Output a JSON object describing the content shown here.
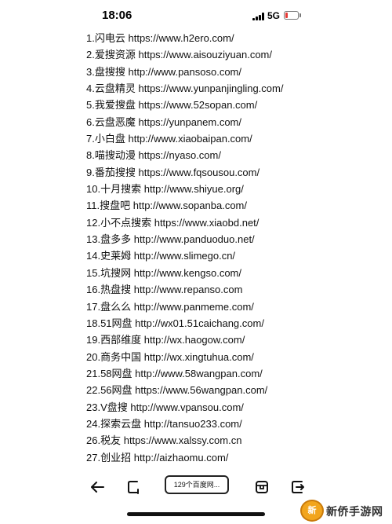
{
  "status_bar": {
    "time": "18:06",
    "network": "5G",
    "battery_level": 0.2
  },
  "sites": [
    {
      "num": "1.",
      "name": "闪电云",
      "url": "https://www.h2ero.com/"
    },
    {
      "num": "2.",
      "name": "爱搜资源",
      "url": "https://www.aisouziyuan.com/"
    },
    {
      "num": "3.",
      "name": "盘搜搜",
      "url": "http://www.pansoso.com/"
    },
    {
      "num": "4.",
      "name": "云盘精灵",
      "url": "https://www.yunpanjingling.com/"
    },
    {
      "num": "5.",
      "name": "我爱搜盘",
      "url": "https://www.52sopan.com/"
    },
    {
      "num": "6.",
      "name": "云盘恶魔",
      "url": "https://yunpanem.com/"
    },
    {
      "num": "7.",
      "name": "小白盘",
      "url": "http://www.xiaobaipan.com/"
    },
    {
      "num": "8.",
      "name": "喵搜动漫",
      "url": "https://nyaso.com/"
    },
    {
      "num": "9.",
      "name": "番茄搜搜",
      "url": "https://www.fqsousou.com/"
    },
    {
      "num": "10.",
      "name": "十月搜索",
      "url": "http://www.shiyue.org/"
    },
    {
      "num": "11.",
      "name": "搜盘吧",
      "url": "http://www.sopanba.com/"
    },
    {
      "num": "12.",
      "name": "小不点搜索",
      "url": "https://www.xiaobd.net/"
    },
    {
      "num": "13.",
      "name": "盘多多",
      "url": "http://www.panduoduo.net/"
    },
    {
      "num": "14.",
      "name": "史莱姆",
      "url": "http://www.slimego.cn/"
    },
    {
      "num": "15.",
      "name": "坑搜网",
      "url": "http://www.kengso.com/"
    },
    {
      "num": "16.",
      "name": "热盘搜",
      "url": "http://www.repanso.com"
    },
    {
      "num": "17.",
      "name": "盘么么",
      "url": "http://www.panmeme.com/"
    },
    {
      "num": "18.",
      "name": "51网盘",
      "url": "http://wx01.51caichang.com/"
    },
    {
      "num": "19.",
      "name": "西部维度",
      "url": "http://wx.haogow.com/"
    },
    {
      "num": "20.",
      "name": "商务中国",
      "url": "http://wx.xingtuhua.com/"
    },
    {
      "num": "21.",
      "name": "58网盘",
      "url": "http://www.58wangpan.com/"
    },
    {
      "num": "22.",
      "name": "56网盘",
      "url": "https://www.56wangpan.com/"
    },
    {
      "num": "23.",
      "name": "V盘搜",
      "url": "http://www.vpansou.com/"
    },
    {
      "num": "24.",
      "name": "探索云盘",
      "url": "http://tansuo233.com/"
    },
    {
      "num": "26.",
      "name": "税友",
      "url": "https://www.xalssy.com.cn"
    },
    {
      "num": "27.",
      "name": "创业招",
      "url": "http://aizhaomu.com/"
    }
  ],
  "toolbar": {
    "tabs_label": "129个百度网..."
  },
  "watermark": {
    "badge": "新",
    "text": "新侨手游网"
  }
}
